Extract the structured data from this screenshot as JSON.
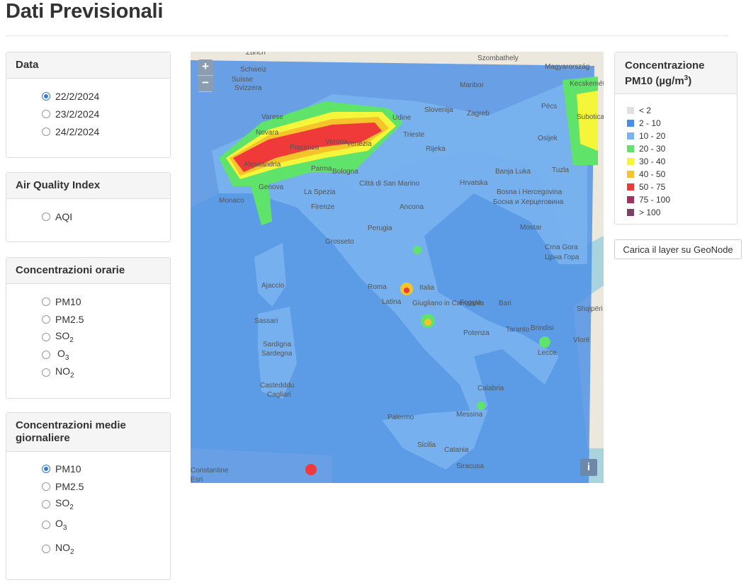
{
  "page_title": "Dati Previsionali",
  "panels": {
    "data": {
      "title": "Data",
      "options": [
        "22/2/2024",
        "23/2/2024",
        "24/2/2024"
      ],
      "selected": 0
    },
    "aqi": {
      "title": "Air Quality Index",
      "options": [
        "AQI"
      ]
    },
    "orarie": {
      "title": "Concentrazioni orarie",
      "options": [
        "PM10",
        "PM2.5",
        "SO",
        "O",
        "NO"
      ],
      "subs": [
        "",
        "",
        "2",
        "3",
        "2"
      ]
    },
    "giornaliere": {
      "title": "Concentrazioni medie giornaliere",
      "options": [
        "PM10",
        "PM2.5",
        "SO",
        "O",
        "NO"
      ],
      "subs": [
        "",
        "",
        "2",
        "3",
        "2"
      ],
      "selected": 0
    }
  },
  "map": {
    "zoom_in": "+",
    "zoom_out": "−",
    "info": "i",
    "labels": [
      "Zürich",
      "Szombathely",
      "Magyarország",
      "Schweiz",
      "Suisse",
      "Svizzera",
      "Maribor",
      "Kecskemét",
      "Slovenija",
      "Zagreb",
      "Pécs",
      "Novara",
      "Varese",
      "Udine",
      "Trieste",
      "Verona",
      "Venezia",
      "Piacenza",
      "Rijeka",
      "Osijek",
      "Subotica",
      "Alessandria",
      "Parma",
      "Bologna",
      "Hrvatska",
      "Banja Luka",
      "Tuzla",
      "Genova",
      "Città di San Marino",
      "Monaco",
      "La Spezia",
      "Ancona",
      "Bosna i Hercegovina",
      "Босна и Херцеговина",
      "Firenze",
      "Mostar",
      "Perugia",
      "Grosseto",
      "Crna Gora",
      "Црна Гора",
      "Ajaccio",
      "Roma",
      "Italia",
      "Latina",
      "Foggia",
      "Bari",
      "Shqipëri",
      "Giugliano in Campania",
      "Brindisi",
      "Taranto",
      "Sassari",
      "Potenza",
      "Lecce",
      "Vlorë",
      "Sardigna",
      "Sardegna",
      "Castedddu",
      "Cagliari",
      "Calabria",
      "Palermo",
      "Messina",
      "Sicilia",
      "Catania",
      "Siracusa",
      "Constantine",
      "Esri"
    ]
  },
  "legend": {
    "title_main": "Concentrazione",
    "title_unit": "PM10 (µg/m",
    "title_sup": "3",
    "title_end": ")",
    "items": [
      {
        "label": "< 2",
        "color": "#e0e0e0"
      },
      {
        "label": "2 - 10",
        "color": "#4a8fe7"
      },
      {
        "label": "10 - 20",
        "color": "#7ab4f0"
      },
      {
        "label": "20 - 30",
        "color": "#5fe36a"
      },
      {
        "label": "30 - 40",
        "color": "#f5f53a"
      },
      {
        "label": "40 - 50",
        "color": "#f5c42a"
      },
      {
        "label": "50 - 75",
        "color": "#f03a3a"
      },
      {
        "label": "75 - 100",
        "color": "#a43060"
      },
      {
        "label": "> 100",
        "color": "#7a4068"
      }
    ]
  },
  "geonode_button": "Carica il layer su GeoNode"
}
